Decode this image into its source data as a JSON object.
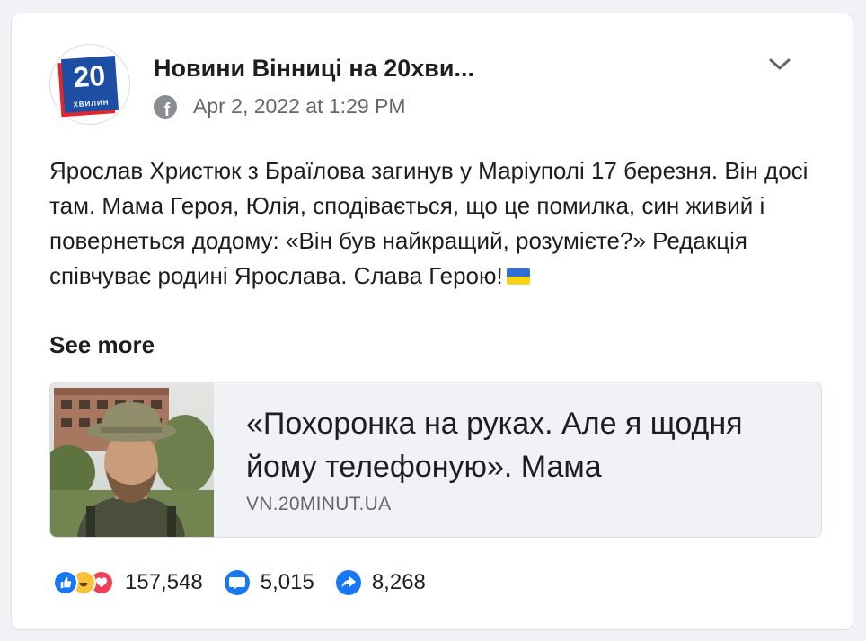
{
  "post": {
    "page_name": "Новини Вінниці на 20хви...",
    "timestamp": "Apr 2, 2022 at 1:29 PM",
    "logo_number": "20",
    "logo_word": "ХВИЛИН",
    "text": "Ярослав Христюк з Браїлова загинув у Маріуполі 17 березня. Він досі там. Мама Героя, Юлія, сподівається, що це помилка, син живий і повернеться додому: «Він був найкращий, розумієте?» Редакція співчуває родині Ярослава. Слава Герою!",
    "see_more": "See more"
  },
  "link_preview": {
    "title": "«Похоронка на руках. Але я щодня йому телефоную». Мама",
    "domain": "VN.20MINUT.UA"
  },
  "stats": {
    "reactions": "157,548",
    "comments": "5,015",
    "shares": "8,268"
  },
  "icons": [
    "facebook-icon",
    "chevron-down-icon",
    "like-reaction-icon",
    "haha-reaction-icon",
    "love-reaction-icon",
    "comment-icon",
    "share-icon"
  ],
  "colors": {
    "facebook_blue": "#1877f2",
    "secondary_text": "#65676b",
    "logo_blue": "#1e4ea3",
    "logo_red": "#e2262b"
  }
}
